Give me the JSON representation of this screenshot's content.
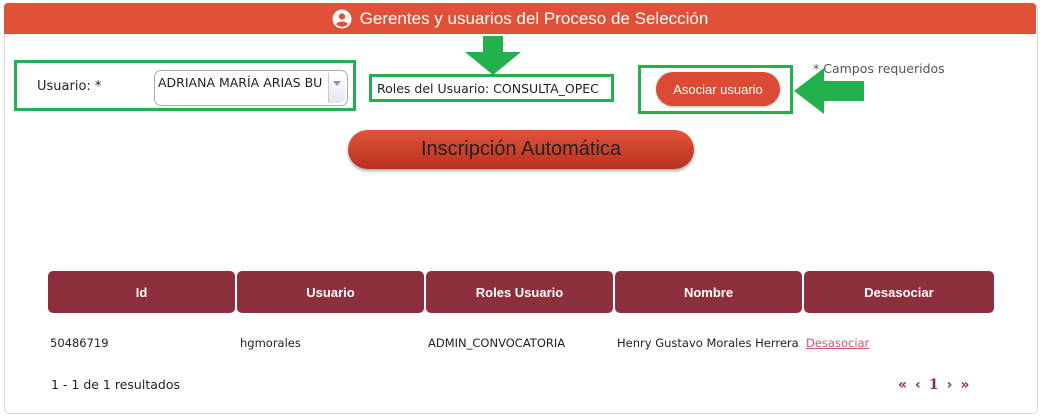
{
  "header": {
    "title": "Gerentes y usuarios del Proceso de Selección",
    "icon": "user-circle-icon"
  },
  "form": {
    "user_label": "Usuario: *",
    "user_selected": "ADRIANA MARÍA ARIAS BU",
    "roles_text": "Roles del Usuario: CONSULTA_OPEC",
    "associate_label": "Asociar usuario",
    "required_note": "* Campos requeridos"
  },
  "inscription_button": "Inscripción Automática",
  "table": {
    "headers": [
      "Id",
      "Usuario",
      "Roles Usuario",
      "Nombre",
      "Desasociar"
    ],
    "rows": [
      {
        "id": "50486719",
        "usuario": "hgmorales",
        "roles": "ADMIN_CONVOCATORIA",
        "nombre": "Henry Gustavo Morales Herrera",
        "action": "Desasociar"
      }
    ]
  },
  "pagination": {
    "summary": "1 - 1 de 1 resultados",
    "first": "«",
    "prev": "‹",
    "current": "1",
    "next": "›",
    "last": "»"
  },
  "colors": {
    "header": "#e15138",
    "table_header": "#8e2f3e",
    "annotation": "#22b14c"
  }
}
